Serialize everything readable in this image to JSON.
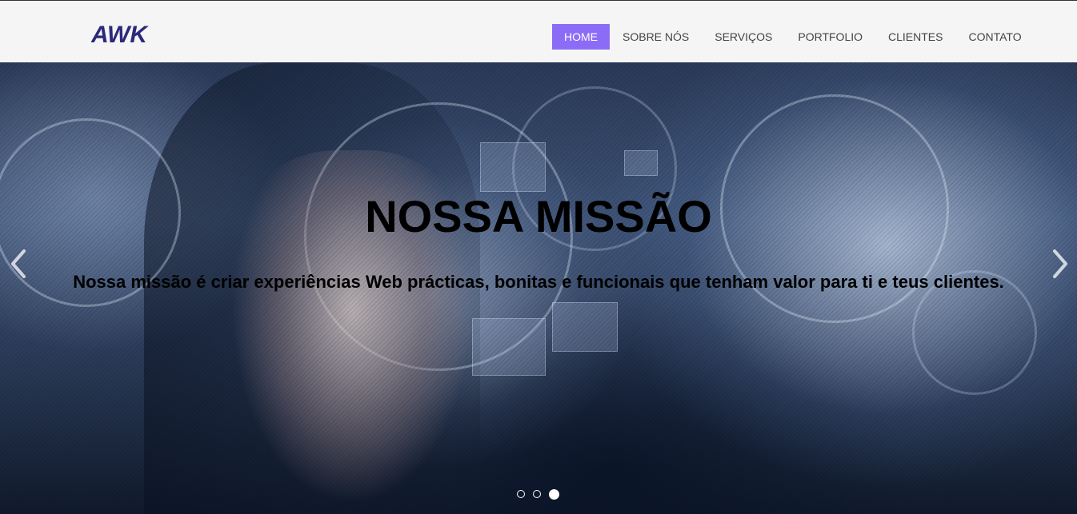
{
  "header": {
    "logo_text": "AWK",
    "nav": [
      {
        "label": "HOME",
        "active": true
      },
      {
        "label": "SOBRE NÓS",
        "active": false
      },
      {
        "label": "SERVIÇOS",
        "active": false
      },
      {
        "label": "PORTFOLIO",
        "active": false
      },
      {
        "label": "CLIENTES",
        "active": false
      },
      {
        "label": "CONTATO",
        "active": false
      }
    ]
  },
  "hero": {
    "title": "NOSSA MISSÃO",
    "text": "Nossa missão é criar experiências Web prácticas, bonitas e funcionais que tenham valor para ti e teus clientes.",
    "prev_icon": "chevron-left-icon",
    "next_icon": "chevron-right-icon",
    "slides": 3,
    "active_slide": 3
  },
  "colors": {
    "accent": "#8c6cf7",
    "logo": "#2b2a7a",
    "header_bg": "#f5f5f5"
  }
}
